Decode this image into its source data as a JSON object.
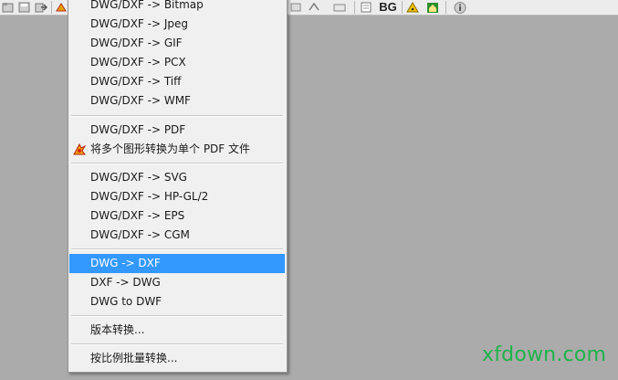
{
  "toolbar": {
    "icons": [
      "open-icon",
      "save-icon",
      "export-icon",
      "convert-icon",
      "layers-icon",
      "print-icon",
      "settings-icon",
      "bg-icon",
      "warning-icon",
      "home-icon",
      "info-icon"
    ],
    "bg_label": "BG"
  },
  "menu": {
    "items": [
      {
        "label": "DWG/DXF -> Bitmap"
      },
      {
        "label": "DWG/DXF -> Jpeg"
      },
      {
        "label": "DWG/DXF -> GIF"
      },
      {
        "label": "DWG/DXF -> PCX"
      },
      {
        "label": "DWG/DXF -> Tiff"
      },
      {
        "label": "DWG/DXF -> WMF"
      },
      {
        "label": "DWG/DXF -> PDF"
      },
      {
        "label": "将多个图形转换为单个 PDF 文件",
        "icon": "pdf-convert-icon"
      },
      {
        "label": "DWG/DXF -> SVG"
      },
      {
        "label": "DWG/DXF -> HP-GL/2"
      },
      {
        "label": "DWG/DXF -> EPS"
      },
      {
        "label": "DWG/DXF -> CGM"
      },
      {
        "label": "DWG -> DXF",
        "selected": true
      },
      {
        "label": "DXF -> DWG"
      },
      {
        "label": "DWG to DWF"
      },
      {
        "label": "版本转换..."
      },
      {
        "label": "按比例批量转换..."
      }
    ],
    "selected_color": "#3399ff"
  },
  "watermark": "xfdown.com"
}
